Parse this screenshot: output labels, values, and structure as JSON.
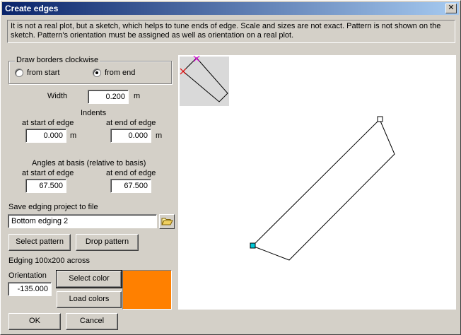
{
  "window": {
    "title": "Create edges"
  },
  "notice": "It is not a real plot, but a sketch, which helps to tune ends of edge. Scale and sizes are not exact. Pattern is not shown on the sketch. Pattern's orientation must be assigned as well as orientation on a real plot.",
  "draw_borders": {
    "title": "Draw borders clockwise",
    "option_start": "from start",
    "option_end": "from end",
    "selected": "from end"
  },
  "width": {
    "label": "Width",
    "value": "0.200",
    "unit": "m"
  },
  "indents": {
    "title": "Indents",
    "start_label": "at start of edge",
    "start_value": "0.000",
    "start_unit": "m",
    "end_label": "at end of edge",
    "end_value": "0.000",
    "end_unit": "m"
  },
  "angles": {
    "title": "Angles at basis (relative to basis)",
    "start_label": "at start of edge",
    "start_value": "67.500",
    "end_label": "at end of edge",
    "end_value": "67.500"
  },
  "save_project": {
    "label": "Save edging project to file",
    "value": "Bottom edging 2"
  },
  "buttons": {
    "select_pattern": "Select pattern",
    "drop_pattern": "Drop pattern",
    "select_color": "Select color",
    "load_colors": "Load colors",
    "ok": "OK",
    "cancel": "Cancel"
  },
  "edging_info": "Edging 100x200 across",
  "orientation": {
    "label": "Orientation",
    "value": "-135.000"
  },
  "colors": {
    "selected_color": "#ff8000",
    "marker_magenta": "#e000e0",
    "marker_red": "#e00000",
    "marker_cyan": "#00c8d8"
  },
  "icons": {
    "close": "close-icon",
    "folder": "folder-open-icon"
  }
}
